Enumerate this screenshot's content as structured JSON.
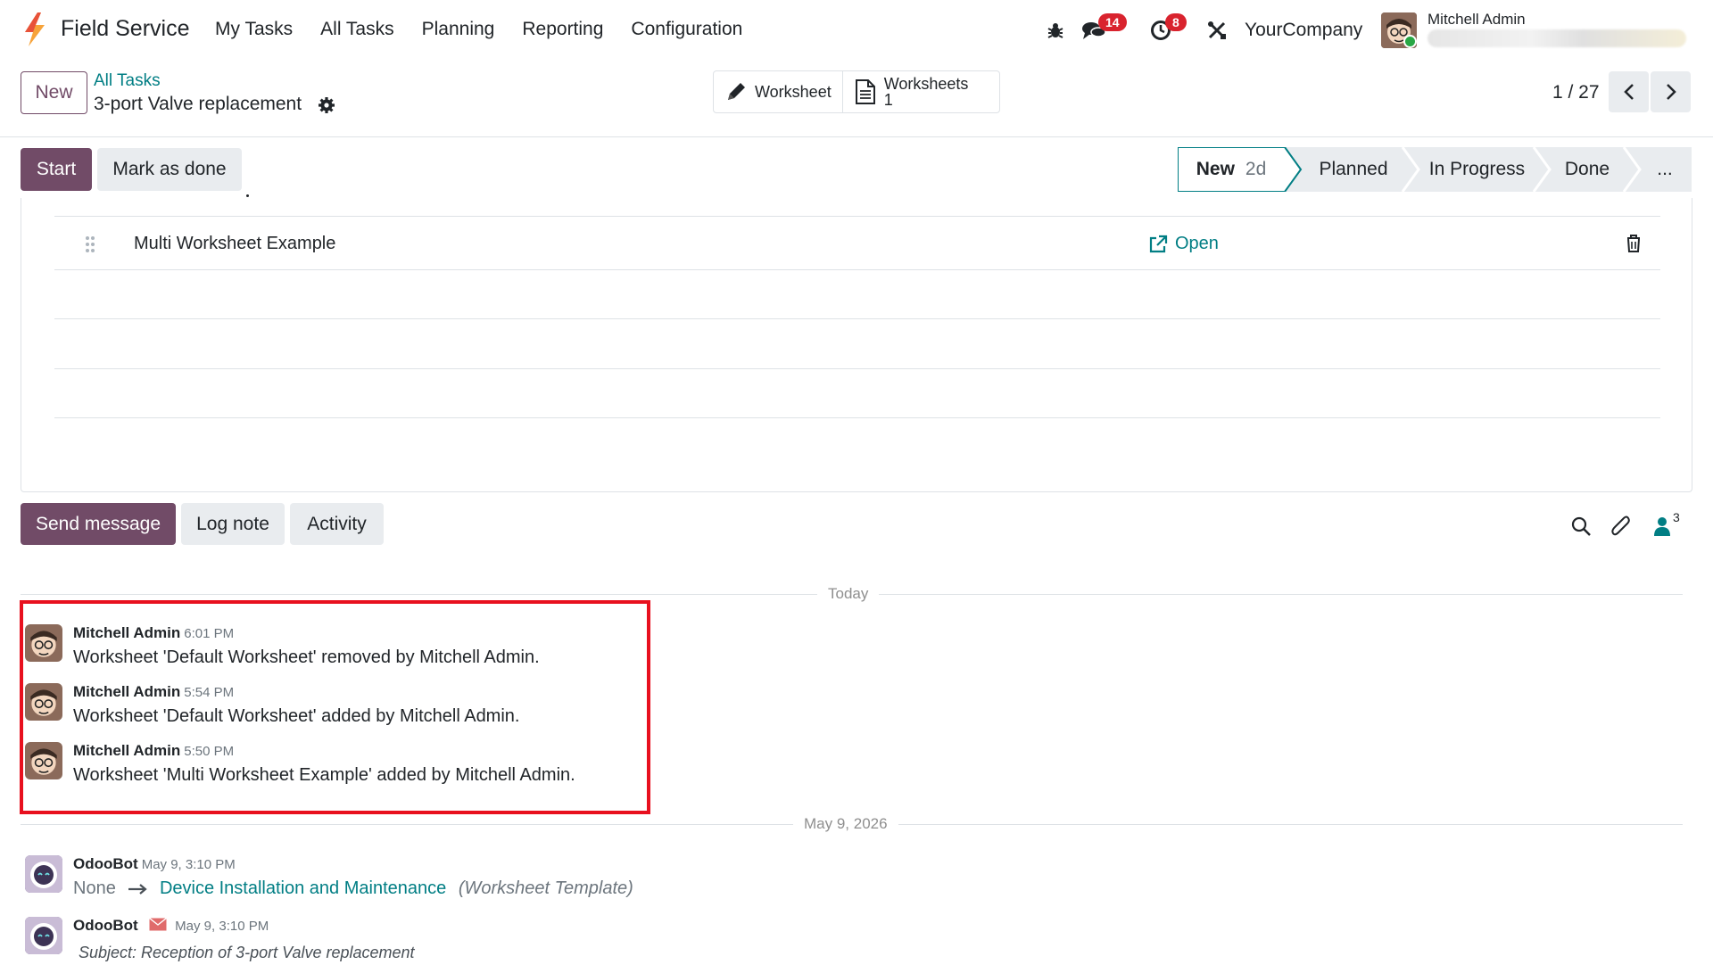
{
  "navbar": {
    "app_title": "Field Service",
    "menu": [
      "My Tasks",
      "All Tasks",
      "Planning",
      "Reporting",
      "Configuration"
    ],
    "messages_badge": "14",
    "activities_badge": "8",
    "company": "YourCompany",
    "user_name": "Mitchell Admin"
  },
  "control_panel": {
    "new_label": "New",
    "breadcrumb_parent": "All Tasks",
    "breadcrumb_current": "3-port Valve replacement",
    "smart_worksheet": "Worksheet",
    "smart_worksheets": "Worksheets",
    "smart_worksheets_count": "1",
    "pager": "1 / 27"
  },
  "statusbar": {
    "start_label": "Start",
    "mark_done_label": "Mark as done",
    "stages": [
      "New",
      "Planned",
      "In Progress",
      "Done",
      "..."
    ],
    "active_stage_days": "2d"
  },
  "worksheets": {
    "row_name": "Multi Worksheet Example",
    "open_label": "Open"
  },
  "chatter": {
    "send_message": "Send message",
    "log_note": "Log note",
    "activity": "Activity",
    "followers_count": "3",
    "separator_today": "Today",
    "separator_past": "May 9, 2026",
    "messages": [
      {
        "author": "Mitchell Admin",
        "time": "6:01 PM",
        "body": "Worksheet 'Default Worksheet' removed by Mitchell Admin."
      },
      {
        "author": "Mitchell Admin",
        "time": "5:54 PM",
        "body": "Worksheet 'Default Worksheet' added by Mitchell Admin."
      },
      {
        "author": "Mitchell Admin",
        "time": "5:50 PM",
        "body": "Worksheet 'Multi Worksheet Example' added by Mitchell Admin."
      }
    ],
    "bot_messages": [
      {
        "author": "OdooBot",
        "time": "May 9, 3:10 PM",
        "old_value": "None",
        "new_value": "Device Installation and Maintenance",
        "field": "(Worksheet Template)"
      },
      {
        "author": "OdooBot",
        "time": "May 9, 3:10 PM",
        "subject": "Subject: Reception of 3-port Valve replacement"
      }
    ]
  },
  "colors": {
    "brand": "#714b67",
    "link": "#017e84",
    "badge": "#d9232e",
    "highlight": "#e8101e"
  }
}
